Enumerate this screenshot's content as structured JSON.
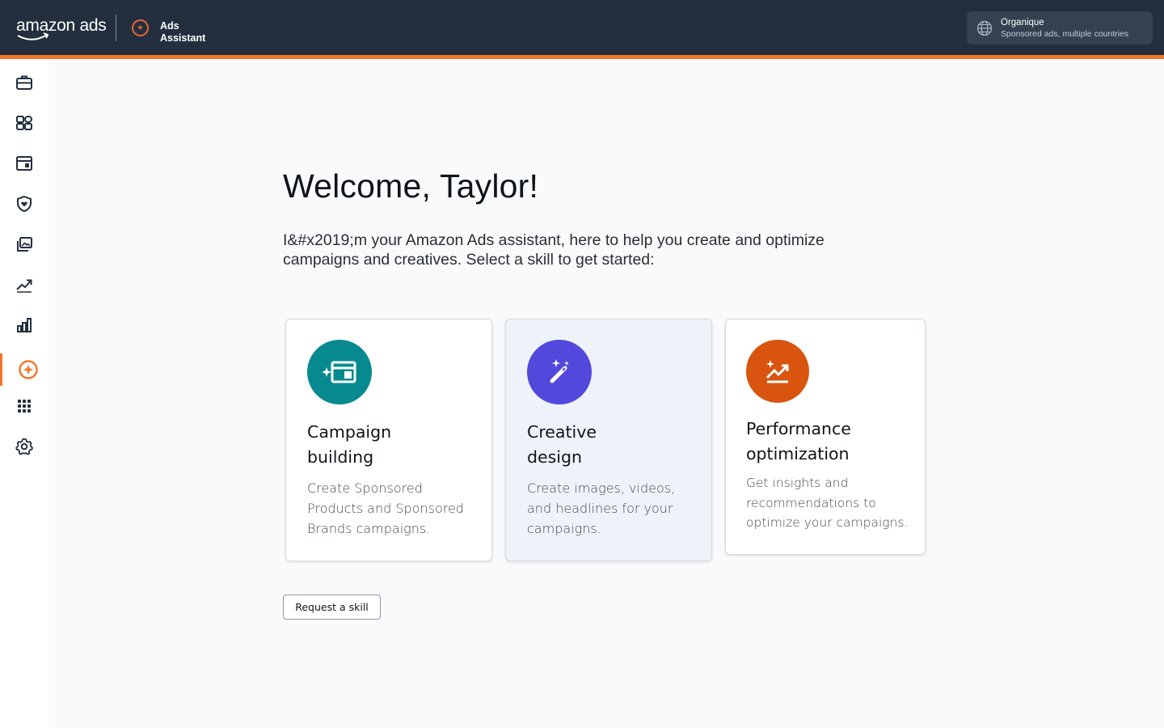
{
  "header": {
    "brand": "amazon ads",
    "assistant_line1": "Ads",
    "assistant_line2": "Assistant",
    "account": {
      "name": "Organique",
      "subtitle": "Sponsored ads, multiple countries"
    }
  },
  "sidebar": {
    "items": [
      {
        "icon": "briefcase-icon"
      },
      {
        "icon": "dashboard-icon"
      },
      {
        "icon": "storefront-icon"
      },
      {
        "icon": "shield-heart-icon"
      },
      {
        "icon": "media-library-icon"
      },
      {
        "icon": "trending-up-icon"
      },
      {
        "icon": "bar-chart-icon"
      },
      {
        "icon": "ads-assistant-icon",
        "active": true
      },
      {
        "icon": "apps-grid-icon"
      },
      {
        "icon": "settings-icon"
      }
    ]
  },
  "main": {
    "welcome": "Welcome, Taylor!",
    "intro": "I&#x2019;m your Amazon Ads assistant, here to help you create and optimize campaigns and creatives. Select a skill to get started:",
    "skills": [
      {
        "title": "Campaign building",
        "description": "Create Sponsored Products and Sponsored Brands campaigns.",
        "icon": "campaign-sparkle-icon",
        "color": "#078a8f"
      },
      {
        "title": "Creative design",
        "description": "Create images, videos, and headlines for your campaigns.",
        "icon": "magic-wand-icon",
        "color": "#5348dc"
      },
      {
        "title": "Performance optimization",
        "description": "Get insights and recommendations to optimize your campaigns.",
        "icon": "trend-sparkle-icon",
        "color": "#d9540e"
      }
    ],
    "request_skill_label": "Request a skill"
  },
  "colors": {
    "topbar": "#232f3e",
    "accent": "#f2742a"
  }
}
